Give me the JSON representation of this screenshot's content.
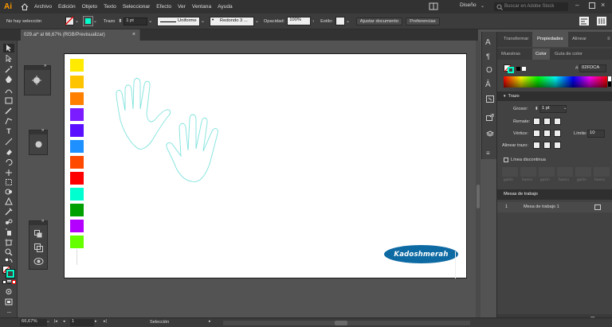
{
  "menubar": {
    "logo": "Ai",
    "items": [
      "Archivo",
      "Edición",
      "Objeto",
      "Texto",
      "Seleccionar",
      "Efecto",
      "Ver",
      "Ventana",
      "Ayuda"
    ],
    "workspace": "Diseño",
    "search_placeholder": "Buscar en Adobe Stock"
  },
  "controlbar": {
    "selection_status": "No hay selección",
    "stroke_label": "Trazo",
    "stroke_weight": "1 pt",
    "stroke_profile": "Uniforme",
    "brush": "Redondo 3 ...",
    "opacity_label": "Opacidad:",
    "opacity_value": "100%",
    "style_label": "Estilo:",
    "adjust_doc_button": "Ajustar documento",
    "preferences_button": "Preferencias"
  },
  "document": {
    "tab_title": "029.ai* al 66,67% (RGB/Previsualizar)",
    "signature_text": "Kadoshmerah",
    "signature_color": "#0d6aa3",
    "hand_stroke_color": "#7fe3dd",
    "swatch_colors": [
      "#ffea00",
      "#ffc400",
      "#ff7f00",
      "#7a1cff",
      "#5a10ff",
      "#1e90ff",
      "#ff4a00",
      "#ff0000",
      "#00ffd0",
      "#00a000",
      "#b400ff",
      "#66ff00"
    ]
  },
  "panels": {
    "tabs": [
      "Transformar",
      "Propiedades",
      "Alinear"
    ],
    "color_tabs": [
      "Muestras",
      "Color",
      "Guía de color"
    ],
    "hex_value": "02FDCA",
    "stroke_section": "Trazo",
    "weight_label": "Grosor:",
    "weight_value": "1 pt",
    "cap_label": "Remate:",
    "corner_label": "Vértice:",
    "limit_label": "Límite:",
    "limit_value": "10",
    "align_label": "Alinear trazo:",
    "dashed_label": "Línea discontinua",
    "dash_labels": [
      "guión",
      "hueco",
      "guión",
      "hueco",
      "guión",
      "hueco"
    ],
    "artboards_section": "Mesas de trabajo",
    "artboard_index": "1",
    "artboard_name": "Mesa de trabajo 1"
  },
  "statusbar": {
    "zoom": "66,67%",
    "page": "1",
    "tool_status": "Selección"
  },
  "colors": {
    "menubar_bg": "#323232",
    "workspace_bg": "#535353",
    "panel_bg": "#424242",
    "accent": "#ff9a00"
  }
}
